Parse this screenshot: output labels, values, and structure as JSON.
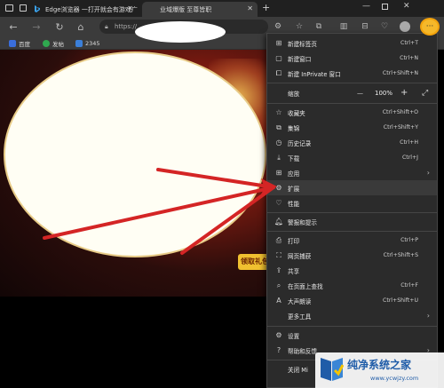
{
  "tabs": [
    {
      "label": "Edge浏览器 一打开就会有游戏广告",
      "active": false
    },
    {
      "label": "业域爆版 至尊皆职",
      "active": true
    }
  ],
  "address": {
    "url": "https://"
  },
  "favorites": [
    {
      "label": "百度",
      "color": "#3a6edb"
    },
    {
      "label": "发帖",
      "color": "#2fa84f"
    },
    {
      "label": "2345",
      "color": "#3b7fd9"
    }
  ],
  "page": {
    "banner_text": "领取礼包"
  },
  "menu": {
    "items": [
      {
        "id": "new-tab",
        "icon": "new-tab-icon",
        "label": "新建标签页",
        "shortcut": "Ctrl+T"
      },
      {
        "id": "new-window",
        "icon": "new-window-icon",
        "label": "新建窗口",
        "shortcut": "Ctrl+N"
      },
      {
        "id": "new-inprivate",
        "icon": "inprivate-icon",
        "label": "新建 InPrivate 窗口",
        "shortcut": "Ctrl+Shift+N"
      },
      {
        "id": "zoom",
        "icon": "",
        "label": "缩放",
        "value": "100%",
        "minus": "—",
        "plus": "+",
        "expand": "⤢"
      },
      {
        "id": "favorites",
        "icon": "favorites-icon",
        "label": "收藏夹",
        "shortcut": "Ctrl+Shift+O"
      },
      {
        "id": "collections",
        "icon": "collections-icon",
        "label": "集锦",
        "shortcut": "Ctrl+Shift+Y"
      },
      {
        "id": "history",
        "icon": "history-icon",
        "label": "历史记录",
        "shortcut": "Ctrl+H"
      },
      {
        "id": "downloads",
        "icon": "download-icon",
        "label": "下载",
        "shortcut": "Ctrl+J"
      },
      {
        "id": "apps",
        "icon": "apps-icon",
        "label": "应用",
        "arrow": "›"
      },
      {
        "id": "extensions",
        "icon": "extensions-icon",
        "label": "扩展"
      },
      {
        "id": "performance",
        "icon": "performance-icon",
        "label": "性能"
      },
      {
        "id": "alerts",
        "icon": "bell-icon",
        "label": "警报和提示"
      },
      {
        "id": "print",
        "icon": "print-icon",
        "label": "打印",
        "shortcut": "Ctrl+P"
      },
      {
        "id": "web-capture",
        "icon": "capture-icon",
        "label": "网页捕获",
        "shortcut": "Ctrl+Shift+S"
      },
      {
        "id": "share",
        "icon": "share-icon",
        "label": "共享"
      },
      {
        "id": "find",
        "icon": "find-icon",
        "label": "在页面上查找",
        "shortcut": "Ctrl+F"
      },
      {
        "id": "read-aloud",
        "icon": "read-aloud-icon",
        "label": "大声朗读",
        "shortcut": "Ctrl+Shift+U"
      },
      {
        "id": "more-tools",
        "icon": "",
        "label": "更多工具",
        "arrow": "›"
      },
      {
        "id": "settings",
        "icon": "gear-icon",
        "label": "设置"
      },
      {
        "id": "help",
        "icon": "help-icon",
        "label": "帮助和反馈",
        "arrow": "›"
      },
      {
        "id": "close",
        "icon": "",
        "label": "关闭 Mi"
      }
    ]
  },
  "watermark": {
    "title": "纯净系统之家",
    "url": "www.ycwjzy.com"
  },
  "colors": {
    "highlight": "#f5b82a",
    "arrow": "#d42525"
  }
}
